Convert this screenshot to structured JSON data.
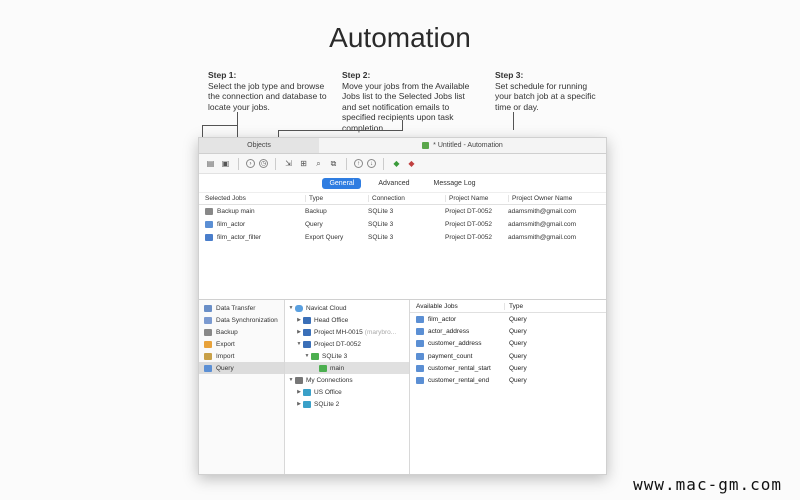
{
  "title": "Automation",
  "steps": [
    {
      "title": "Step 1:",
      "text": "Select the job type and browse the connection and database to locate your jobs."
    },
    {
      "title": "Step 2:",
      "text": "Move your jobs from the Available Jobs list to the Selected Jobs list and set notification emails to specified recipients upon task completion."
    },
    {
      "title": "Step 3:",
      "text": "Set schedule for running your batch job at a specific time or day."
    }
  ],
  "window": {
    "tabs": {
      "objects": "Objects",
      "automation": "* Untitled - Automation"
    },
    "subtabs": {
      "general": "General",
      "advanced": "Advanced",
      "message_log": "Message Log"
    },
    "selected_jobs": {
      "headers": [
        "Selected Jobs",
        "Type",
        "Connection",
        "Project Name",
        "Project Owner Name"
      ],
      "rows": [
        {
          "job": "Backup main",
          "type": "Backup",
          "connection": "SQLite 3",
          "project": "Project DT-0052",
          "owner": "adamsmith@gmail.com"
        },
        {
          "job": "film_actor",
          "type": "Query",
          "connection": "SQLite 3",
          "project": "Project DT-0052",
          "owner": "adamsmith@gmail.com"
        },
        {
          "job": "film_actor_filter",
          "type": "Export Query",
          "connection": "SQLite 3",
          "project": "Project DT-0052",
          "owner": "adamsmith@gmail.com"
        }
      ]
    },
    "job_types": [
      "Data Transfer",
      "Data Synchronization",
      "Backup",
      "Export",
      "Import",
      "Query"
    ],
    "tree": {
      "cloud": "Navicat Cloud",
      "head_office": "Head Office",
      "project_mh": "Project MH-0015",
      "project_mh_owner": "(marybro...",
      "project_dt": "Project DT-0052",
      "sqlite3": "SQLite 3",
      "main": "main",
      "my_connections": "My Connections",
      "us_office": "US Office",
      "sqlite2": "SQLite 2"
    },
    "available_jobs": {
      "headers": [
        "Available Jobs",
        "Type"
      ],
      "rows": [
        {
          "name": "film_actor",
          "type": "Query"
        },
        {
          "name": "actor_address",
          "type": "Query"
        },
        {
          "name": "customer_address",
          "type": "Query"
        },
        {
          "name": "payment_count",
          "type": "Query"
        },
        {
          "name": "customer_rental_start",
          "type": "Query"
        },
        {
          "name": "customer_rental_end",
          "type": "Query"
        }
      ]
    }
  },
  "watermark": "www.mac-gm.com"
}
